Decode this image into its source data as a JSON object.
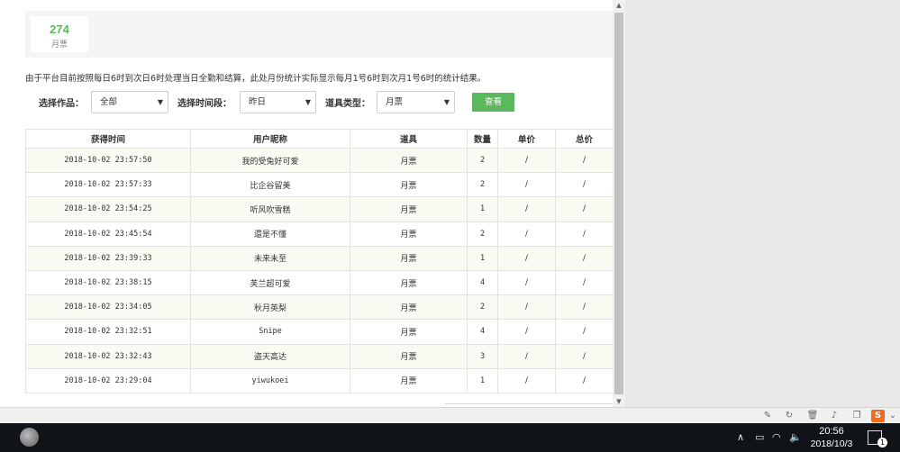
{
  "stat": {
    "value": "274",
    "label": "月票"
  },
  "notice": "由于平台目前按照每日6时到次日6时处理当日全勤和结算，此处月份统计实际显示每月1号6时到次月1号6时的统计结果。",
  "filters": {
    "work_label": "选择作品：",
    "work_value": "全部",
    "period_label": "选择时间段：",
    "period_value": "昨日",
    "item_type_label": "道具类型：",
    "item_type_value": "月票",
    "query_label": "查看"
  },
  "table": {
    "headers": [
      "获得时间",
      "用户昵称",
      "道具",
      "数量",
      "单价",
      "总价"
    ],
    "rows": [
      [
        "2018-10-02 23:57:50",
        "我的受兔好可爱",
        "月票",
        "2",
        "/",
        "/"
      ],
      [
        "2018-10-02 23:57:33",
        "比企谷留美",
        "月票",
        "2",
        "/",
        "/"
      ],
      [
        "2018-10-02 23:54:25",
        "听风吹雪糕",
        "月票",
        "1",
        "/",
        "/"
      ],
      [
        "2018-10-02 23:45:54",
        "還是不懂",
        "月票",
        "2",
        "/",
        "/"
      ],
      [
        "2018-10-02 23:39:33",
        "未来未至",
        "月票",
        "1",
        "/",
        "/"
      ],
      [
        "2018-10-02 23:38:15",
        "芙兰超可爱",
        "月票",
        "4",
        "/",
        "/"
      ],
      [
        "2018-10-02 23:34:05",
        "秋月英梨",
        "月票",
        "2",
        "/",
        "/"
      ],
      [
        "2018-10-02 23:32:51",
        "Snipe",
        "月票",
        "4",
        "/",
        "/"
      ],
      [
        "2018-10-02 23:32:43",
        "盗天高达",
        "月票",
        "3",
        "/",
        "/"
      ],
      [
        "2018-10-02 23:29:04",
        "yiwukoei",
        "月票",
        "1",
        "/",
        "/"
      ]
    ]
  },
  "taskbar": {
    "time": "20:56",
    "date": "2018/10/3",
    "notification_count": "1"
  },
  "icons": {
    "status_bar": [
      "brush-icon",
      "refresh-icon",
      "trash-icon",
      "speaker-icon",
      "window-icon",
      "chevron-down-icon",
      "sogou-s-icon"
    ],
    "tray": [
      "chevron-up-icon",
      "battery-icon",
      "wifi-icon",
      "volume-icon",
      "notification-icon"
    ]
  },
  "colors": {
    "accent_green": "#5cb85c",
    "row_tint": "#f7fbf2",
    "sogou_orange": "#f26b1d"
  }
}
